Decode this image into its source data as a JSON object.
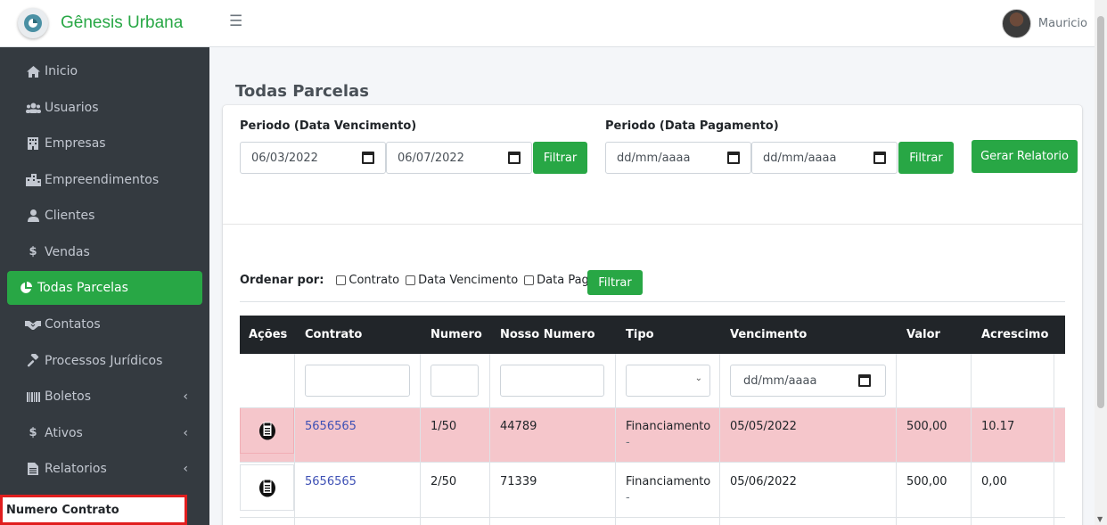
{
  "brand": {
    "name": "Gênesis Urbana"
  },
  "user": {
    "name": "Mauricio"
  },
  "sidebar": {
    "items": [
      {
        "label": "Inicio",
        "icon": "home-icon"
      },
      {
        "label": "Usuarios",
        "icon": "users-icon"
      },
      {
        "label": "Empresas",
        "icon": "building-icon"
      },
      {
        "label": "Empreendimentos",
        "icon": "city-icon"
      },
      {
        "label": "Clientes",
        "icon": "user-icon"
      },
      {
        "label": "Vendas",
        "icon": "dollar-icon"
      },
      {
        "label": "Todas Parcelas",
        "icon": "pie-chart-icon",
        "active": true
      },
      {
        "label": "Contatos",
        "icon": "handshake-icon"
      },
      {
        "label": "Processos Jurídicos",
        "icon": "gavel-icon"
      },
      {
        "label": "Boletos",
        "icon": "barcode-icon",
        "expandable": true
      },
      {
        "label": "Ativos",
        "icon": "dollar-icon",
        "expandable": true
      },
      {
        "label": "Relatorios",
        "icon": "file-icon",
        "expandable": true
      }
    ],
    "tooltip": "Numero Contrato"
  },
  "page": {
    "title": "Todas Parcelas"
  },
  "filters": {
    "vencimento": {
      "label": "Periodo (Data Vencimento)",
      "start": "06/03/2022",
      "end": "06/07/2022",
      "button": "Filtrar"
    },
    "pagamento": {
      "label": "Periodo (Data Pagamento)",
      "start": "dd/mm/aaaa",
      "end": "dd/mm/aaaa",
      "button": "Filtrar"
    },
    "report_button": "Gerar Relatorio"
  },
  "order": {
    "label": "Ordenar por:",
    "options": [
      "Contrato",
      "Data Vencimento",
      "Data Pago"
    ],
    "button": "Filtrar"
  },
  "table": {
    "columns": [
      "Ações",
      "Contrato",
      "Numero",
      "Nosso Numero",
      "Tipo",
      "Vencimento",
      "Valor",
      "Acrescimo"
    ],
    "date_placeholder": "dd/mm/aaaa",
    "rows": [
      {
        "contrato": "5656565",
        "numero": "1/50",
        "nosso_numero": "44789",
        "tipo": "Financiamento",
        "tipo_sub": "-",
        "vencimento": "05/05/2022",
        "valor": "500,00",
        "acrescimo": "10.17",
        "highlight": true
      },
      {
        "contrato": "5656565",
        "numero": "2/50",
        "nosso_numero": "71339",
        "tipo": "Financiamento",
        "tipo_sub": "-",
        "vencimento": "05/06/2022",
        "valor": "500,00",
        "acrescimo": "0,00",
        "highlight": false
      }
    ]
  },
  "colors": {
    "accent": "#28a745",
    "sidebar": "#343a40",
    "highlight_row": "#f5c6cb",
    "link": "#3f51b5"
  }
}
